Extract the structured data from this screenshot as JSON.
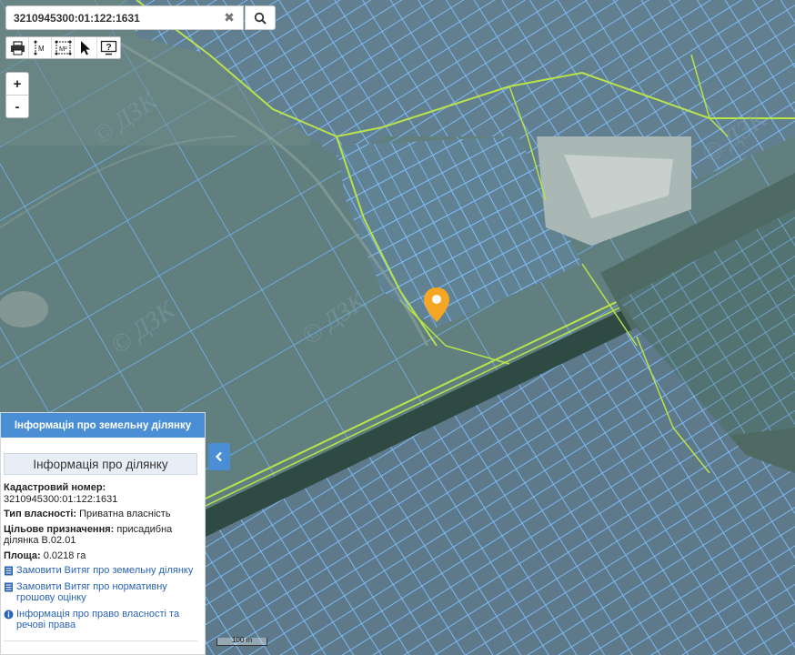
{
  "search": {
    "value": "3210945300:01:122:1631",
    "clear_glyph": "✖",
    "search_icon": "search-icon"
  },
  "toolbar": {
    "tools": [
      {
        "name": "print-icon"
      },
      {
        "name": "measure-distance-icon",
        "label": "M"
      },
      {
        "name": "measure-area-icon",
        "label": "M²"
      },
      {
        "name": "pointer-icon"
      },
      {
        "name": "help-icon",
        "label": "?"
      }
    ]
  },
  "zoom": {
    "in": "+",
    "out": "-"
  },
  "panel": {
    "header": "Інформація про земельну ділянку",
    "subheader": "Інформація про ділянку",
    "cadastral_label": "Кадастровий номер:",
    "cadastral_value": "3210945300:01:122:1631",
    "ownership_label": "Тип власності:",
    "ownership_value": "Приватна власність",
    "purpose_label": "Цільове призначення:",
    "purpose_value": "присадибна ділянка В.02.01",
    "area_label": "Площа:",
    "area_value": "0.0218 га",
    "links": [
      "Замовити Витяг про земельну ділянку",
      "Замовити Витяг про нормативну грошову оцінку",
      "Інформація про право власності та речові права"
    ]
  },
  "scale_bar": {
    "label": "100 m"
  },
  "watermarks": [
    "© ДЗК",
    "© ДЗК",
    "© ДЗК",
    "© ДЗК"
  ],
  "colors": {
    "panel_header": "#4a8fd6",
    "parcel_outline": "#7fbfff",
    "boundary_line": "#b9e34a",
    "marker": "#f5a623",
    "link": "#2a63b3"
  }
}
